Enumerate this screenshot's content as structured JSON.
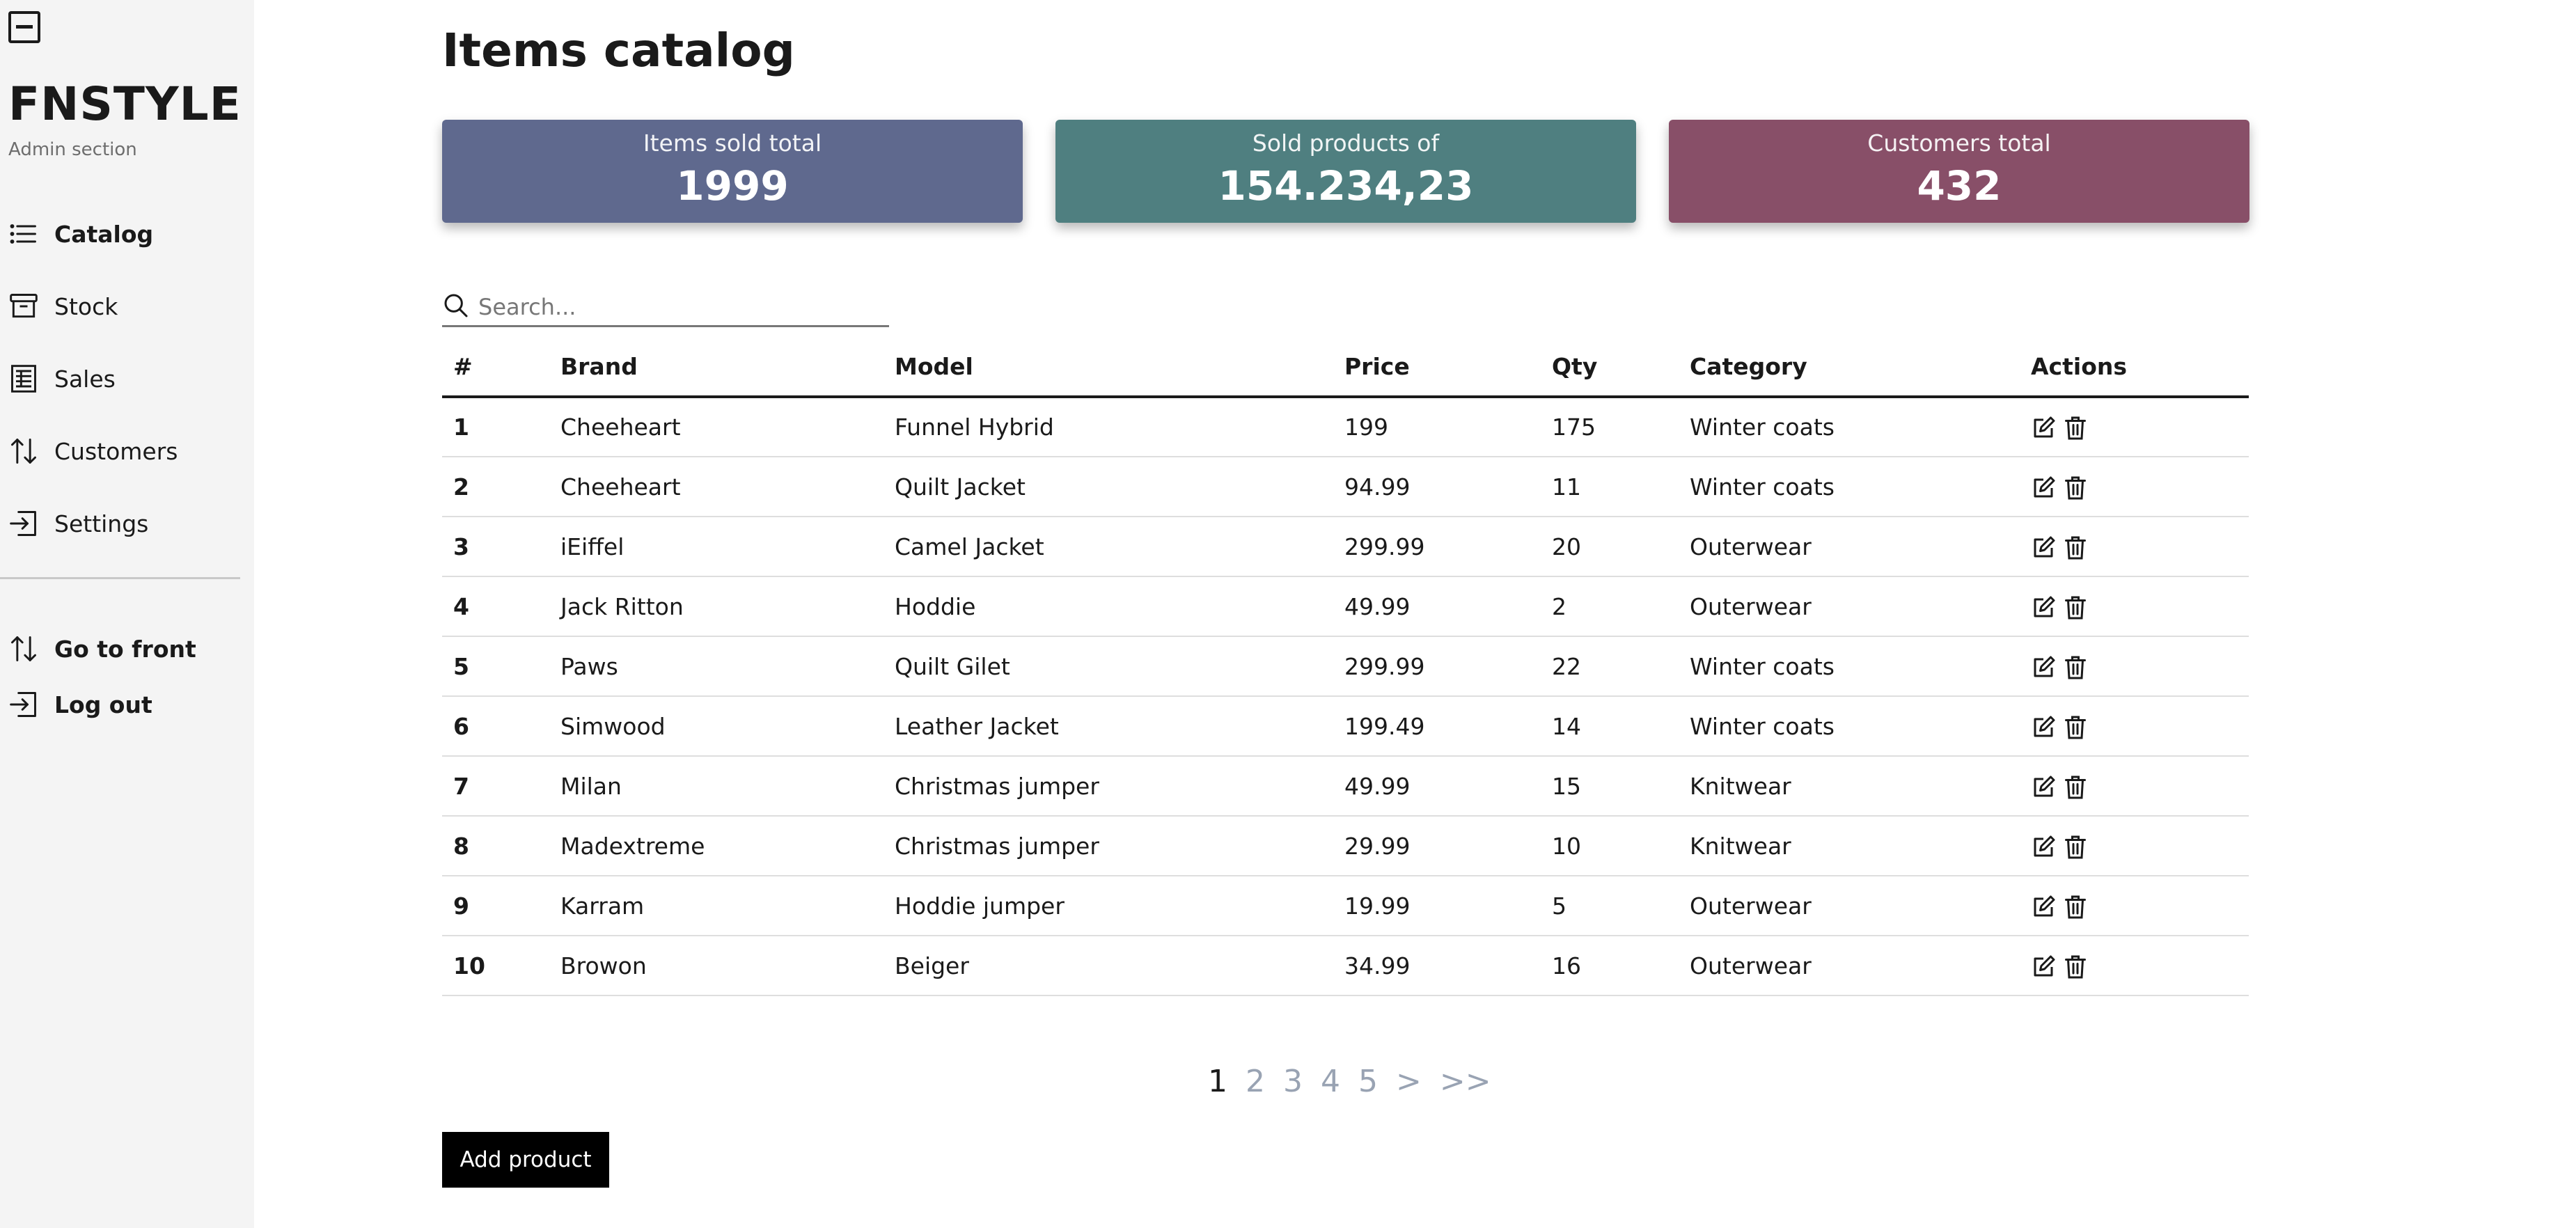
{
  "sidebar": {
    "toggle_icon": "minus-square-icon",
    "brand": "FNSTYLE",
    "subtitle": "Admin section",
    "items": [
      {
        "label": "Catalog",
        "icon": "list-icon",
        "active": true
      },
      {
        "label": "Stock",
        "icon": "archive-icon",
        "active": false
      },
      {
        "label": "Sales",
        "icon": "receipt-icon",
        "active": false
      },
      {
        "label": "Customers",
        "icon": "arrows-up-down-icon",
        "active": false
      },
      {
        "label": "Settings",
        "icon": "sign-in-icon",
        "active": false
      }
    ],
    "footer_items": [
      {
        "label": "Go to front",
        "icon": "arrows-up-down-icon"
      },
      {
        "label": "Log out",
        "icon": "sign-in-icon"
      }
    ]
  },
  "page": {
    "title": "Items catalog"
  },
  "stats": [
    {
      "label": "Items sold total",
      "value": "1999",
      "color": "#5f698e"
    },
    {
      "label": "Sold products of",
      "value": "154.234,23",
      "color": "#4f7f80"
    },
    {
      "label": "Customers total",
      "value": "432",
      "color": "#884f68"
    }
  ],
  "search": {
    "placeholder": "Search...",
    "value": "",
    "icon": "search-icon"
  },
  "table": {
    "headers": [
      "#",
      "Brand",
      "Model",
      "Price",
      "Qty",
      "Category",
      "Actions"
    ],
    "rows": [
      [
        "1",
        "Cheeheart",
        "Funnel Hybrid",
        "199",
        "175",
        "Winter coats"
      ],
      [
        "2",
        "Cheeheart",
        "Quilt Jacket",
        "94.99",
        "11",
        "Winter coats"
      ],
      [
        "3",
        "iEiffel",
        "Camel Jacket",
        "299.99",
        "20",
        "Outerwear"
      ],
      [
        "4",
        "Jack Ritton",
        "Hoddie",
        "49.99",
        "2",
        "Outerwear"
      ],
      [
        "5",
        "Paws",
        "Quilt Gilet",
        "299.99",
        "22",
        "Winter coats"
      ],
      [
        "6",
        "Simwood",
        "Leather Jacket",
        "199.49",
        "14",
        "Winter coats"
      ],
      [
        "7",
        "Milan",
        "Christmas jumper",
        "49.99",
        "15",
        "Knitwear"
      ],
      [
        "8",
        "Madextreme",
        "Christmas jumper",
        "29.99",
        "10",
        "Knitwear"
      ],
      [
        "9",
        "Karram",
        "Hoddie jumper",
        "19.99",
        "5",
        "Outerwear"
      ],
      [
        "10",
        "Browon",
        "Beiger",
        "34.99",
        "16",
        "Outerwear"
      ]
    ],
    "action_icons": [
      "edit-icon",
      "trash-icon"
    ]
  },
  "pagination": {
    "pages": [
      "1",
      "2",
      "3",
      "4",
      "5"
    ],
    "next": ">",
    "last": ">>",
    "current": "1"
  },
  "add_button": {
    "label": "Add product"
  },
  "colors": {
    "sidebar_bg": "#f4f4f4",
    "accent_text": "#1a1a1a",
    "pagination_inactive": "#99a3b3"
  }
}
